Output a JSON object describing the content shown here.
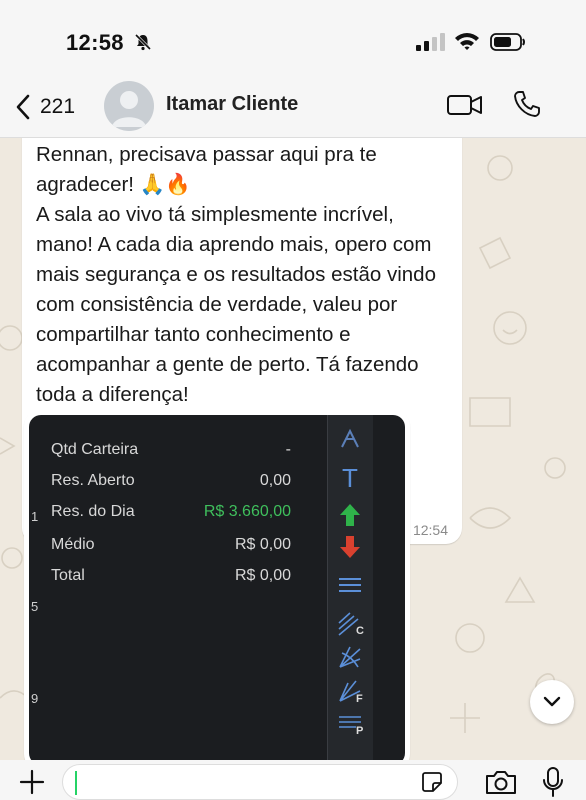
{
  "status_bar": {
    "time": "12:58"
  },
  "header": {
    "back_count": "221",
    "contact_name": "Itamar Cliente"
  },
  "message": {
    "text": "Rennan, precisava passar aqui pra te agradecer! 🙏🔥\nA sala ao vivo tá simplesmente incrível, mano! A cada dia aprendo mais, opero com mais segurança e os resultados estão vindo com consistência de verdade, valeu por compartilhar tanto conhecimento e acompanhar a gente de perto. Tá fazendo toda a diferença!",
    "time": "12:54"
  },
  "image_panel": {
    "rows": [
      {
        "label": "Qtd Carteira",
        "value": "-"
      },
      {
        "label": "Res. Aberto",
        "value": "0,00"
      },
      {
        "label": "Res. do Dia",
        "value": "R$ 3.660,00"
      },
      {
        "label": "Médio",
        "value": "R$ 0,00"
      },
      {
        "label": "Total",
        "value": "R$ 0,00"
      }
    ],
    "side_numbers": [
      "1",
      "5",
      "9"
    ],
    "toolbar_letters": [
      "T",
      "C",
      "F",
      "P"
    ]
  },
  "colors": {
    "chat_background": "#efe9df",
    "bubble": "#ffffff",
    "accent_green": "#25d366",
    "positive_value": "#3fbf5c"
  },
  "icons": [
    "bell-slash-icon",
    "signal-icon",
    "wifi-icon",
    "battery-icon",
    "chevron-left-icon",
    "avatar-icon",
    "video-call-icon",
    "phone-icon",
    "chevron-down-icon",
    "plus-icon",
    "sticker-icon",
    "camera-icon",
    "microphone-icon"
  ]
}
